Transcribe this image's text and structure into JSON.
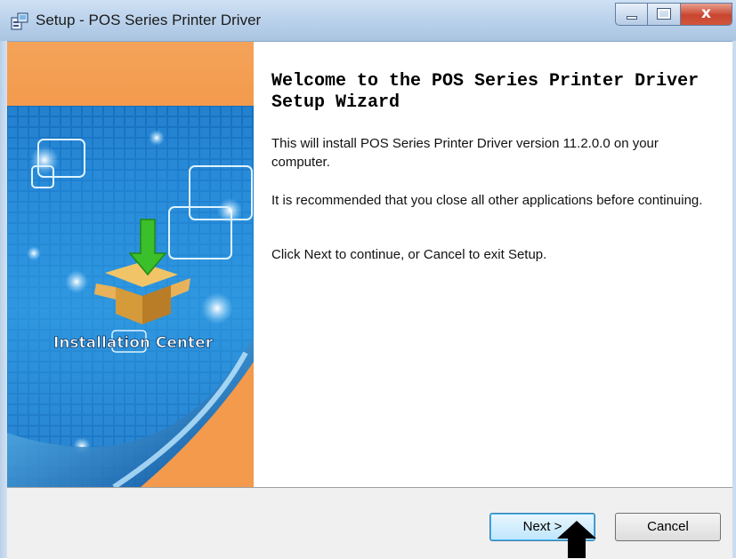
{
  "window": {
    "title": "Setup - POS Series Printer Driver",
    "app_icon": "setup-installer-icon",
    "controls": [
      "minimize-icon",
      "maximize-icon",
      "close-icon"
    ],
    "close_glyph": "x"
  },
  "banner": {
    "caption": "Installation Center"
  },
  "main": {
    "heading": "Welcome to the POS Series Printer Driver Setup Wizard",
    "paragraph_1": "This will install POS Series Printer Driver version 11.2.0.0 on your computer.",
    "paragraph_2": "It is recommended that you close all other applications before continuing.",
    "paragraph_3": "Click Next to continue, or Cancel to exit Setup."
  },
  "footer": {
    "next_label": "Next >",
    "cancel_label": "Cancel"
  },
  "colors": {
    "banner_orange": "#f39a4c",
    "banner_blue": "#1f7fd0",
    "next_button_focus": "#48b8f0"
  }
}
